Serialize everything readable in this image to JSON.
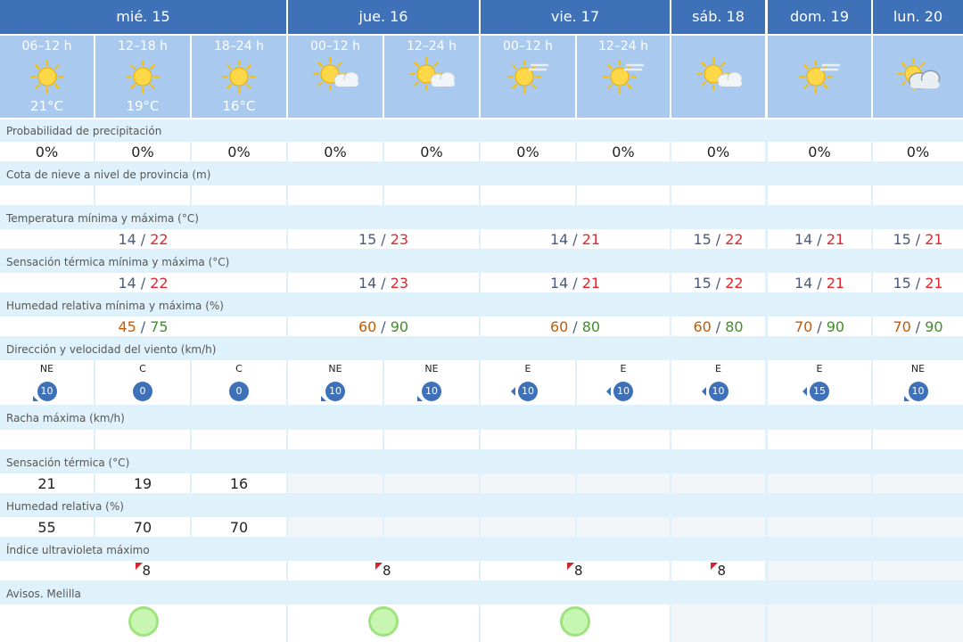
{
  "days": [
    {
      "label": "mié. 15"
    },
    {
      "label": "jue. 16"
    },
    {
      "label": "vie. 17"
    },
    {
      "label": "sáb. 18"
    },
    {
      "label": "dom. 19"
    },
    {
      "label": "lun. 20"
    }
  ],
  "periods": [
    {
      "label": "06–12 h",
      "temp": "21°C",
      "icon": "sun-icon"
    },
    {
      "label": "12–18 h",
      "temp": "19°C",
      "icon": "sun-icon"
    },
    {
      "label": "18–24 h",
      "temp": "16°C",
      "icon": "sun-icon"
    },
    {
      "label": "00–12 h",
      "temp": "",
      "icon": "sun-cloud-icon"
    },
    {
      "label": "12–24 h",
      "temp": "",
      "icon": "sun-cloud-icon"
    },
    {
      "label": "00–12 h",
      "temp": "",
      "icon": "sun-haze-icon"
    },
    {
      "label": "12–24 h",
      "temp": "",
      "icon": "sun-haze-icon"
    },
    {
      "label": "",
      "temp": "",
      "icon": "sun-cloud-icon"
    },
    {
      "label": "",
      "temp": "",
      "icon": "sun-haze-icon"
    },
    {
      "label": "",
      "temp": "",
      "icon": "cloud-sun-icon"
    }
  ],
  "rows": {
    "precip": {
      "label": "Probabilidad de precipitación",
      "values": [
        "0%",
        "0%",
        "0%",
        "0%",
        "0%",
        "0%",
        "0%",
        "0%",
        "0%",
        "0%"
      ]
    },
    "snow": {
      "label": "Cota de nieve a nivel de provincia (m)"
    },
    "temp": {
      "label": "Temperatura mínima y máxima (°C)",
      "values": [
        {
          "min": "14",
          "max": "22"
        },
        {
          "min": "15",
          "max": "23"
        },
        {
          "min": "14",
          "max": "21"
        },
        {
          "min": "15",
          "max": "22"
        },
        {
          "min": "14",
          "max": "21"
        },
        {
          "min": "15",
          "max": "21"
        }
      ]
    },
    "feels": {
      "label": "Sensación térmica mínima y máxima (°C)",
      "values": [
        {
          "min": "14",
          "max": "22"
        },
        {
          "min": "14",
          "max": "23"
        },
        {
          "min": "14",
          "max": "21"
        },
        {
          "min": "15",
          "max": "22"
        },
        {
          "min": "14",
          "max": "21"
        },
        {
          "min": "15",
          "max": "21"
        }
      ]
    },
    "humid": {
      "label": "Humedad relativa mínima y máxima (%)",
      "values": [
        {
          "min": "45",
          "max": "75"
        },
        {
          "min": "60",
          "max": "90"
        },
        {
          "min": "60",
          "max": "80"
        },
        {
          "min": "60",
          "max": "80"
        },
        {
          "min": "70",
          "max": "90"
        },
        {
          "min": "70",
          "max": "90"
        }
      ]
    },
    "wind": {
      "label": "Dirección y velocidad del viento (km/h)",
      "values": [
        {
          "dir": "NE",
          "speed": "10"
        },
        {
          "dir": "C",
          "speed": "0"
        },
        {
          "dir": "C",
          "speed": "0"
        },
        {
          "dir": "NE",
          "speed": "10"
        },
        {
          "dir": "NE",
          "speed": "10"
        },
        {
          "dir": "E",
          "speed": "10"
        },
        {
          "dir": "E",
          "speed": "10"
        },
        {
          "dir": "E",
          "speed": "10"
        },
        {
          "dir": "E",
          "speed": "15"
        },
        {
          "dir": "NE",
          "speed": "10"
        }
      ]
    },
    "gust": {
      "label": "Racha máxima (km/h)"
    },
    "st": {
      "label": "Sensación térmica (°C)",
      "values": [
        "21",
        "19",
        "16"
      ]
    },
    "hr": {
      "label": "Humedad relativa (%)",
      "values": [
        "55",
        "70",
        "70"
      ]
    },
    "uv": {
      "label": "Índice ultravioleta máximo",
      "values": [
        "8",
        "8",
        "8",
        "8"
      ]
    },
    "avisos": {
      "label": "Avisos. Melilla"
    }
  },
  "colors": {
    "header": "#3e71b7",
    "period": "#a9c9ef",
    "band": "#dff2fb",
    "max": "#e1262d",
    "min": "#4a5c7a",
    "hmin": "#c65a00",
    "hmax": "#3f8f2a",
    "avisos": "#c7f6b3"
  }
}
